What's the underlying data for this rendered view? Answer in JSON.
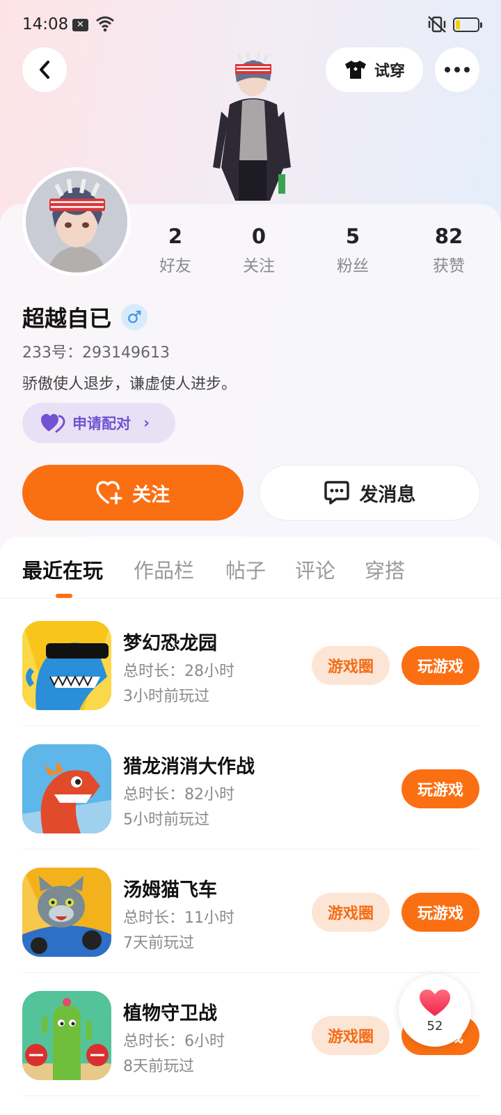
{
  "status_bar": {
    "time": "14:08"
  },
  "header": {
    "try_on_label": "试穿"
  },
  "stats": [
    {
      "value": "2",
      "label": "好友"
    },
    {
      "value": "0",
      "label": "关注"
    },
    {
      "value": "5",
      "label": "粉丝"
    },
    {
      "value": "82",
      "label": "获赞"
    }
  ],
  "profile": {
    "username": "超越自已",
    "gender_symbol": "♂",
    "id_text": "233号：293149613",
    "bio": "骄傲使人退步，谦虚使人进步。",
    "pair_label": "申请配对"
  },
  "actions": {
    "follow_label": "关注",
    "message_label": "发消息"
  },
  "tabs": [
    "最近在玩",
    "作品栏",
    "帖子",
    "评论",
    "穿搭"
  ],
  "games": [
    {
      "name": "梦幻恐龙园",
      "duration": "总时长：28小时",
      "last_played": "3小时前玩过",
      "circle_label": "游戏圈",
      "play_label": "玩游戏",
      "has_circle": true
    },
    {
      "name": "猎龙消消大作战",
      "duration": "总时长：82小时",
      "last_played": "5小时前玩过",
      "circle_label": "",
      "play_label": "玩游戏",
      "has_circle": false
    },
    {
      "name": "汤姆猫飞车",
      "duration": "总时长：11小时",
      "last_played": "7天前玩过",
      "circle_label": "游戏圈",
      "play_label": "玩游戏",
      "has_circle": true
    },
    {
      "name": "植物守卫战",
      "duration": "总时长：6小时",
      "last_played": "8天前玩过",
      "circle_label": "游戏圈",
      "play_label": "玩游戏",
      "has_circle": true
    }
  ],
  "like_float": {
    "count": "52"
  },
  "colors": {
    "accent": "#fb6f13",
    "accent_soft": "#fde5d6",
    "pair_purple": "#7251d2",
    "pair_bg": "#e8e1f6"
  }
}
